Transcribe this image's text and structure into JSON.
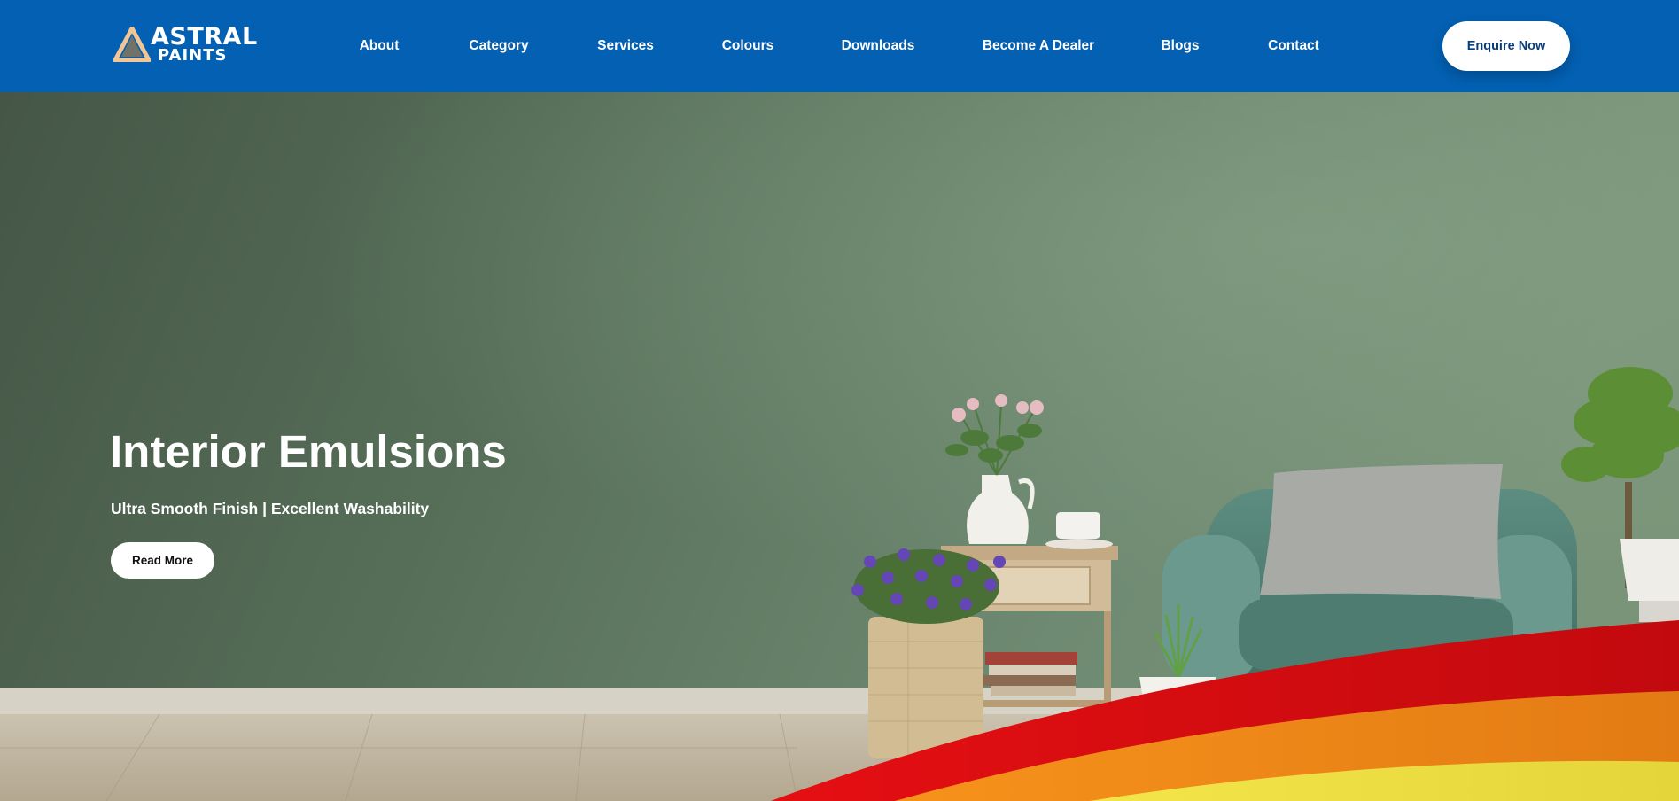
{
  "brand": {
    "logo_line1": "ASTRAL",
    "logo_line2": "PAINTS"
  },
  "nav": {
    "items": [
      {
        "label": "About"
      },
      {
        "label": "Category"
      },
      {
        "label": "Services"
      },
      {
        "label": "Colours"
      },
      {
        "label": "Downloads"
      },
      {
        "label": "Become A Dealer"
      },
      {
        "label": "Blogs"
      },
      {
        "label": "Contact"
      }
    ],
    "cta_label": "Enquire Now"
  },
  "hero": {
    "title": "Interior Emulsions",
    "subtitle": "Ultra Smooth Finish | Excellent Washability",
    "button_label": "Read More"
  },
  "colors": {
    "nav_background": "#0360b2",
    "wall_green": "#5b7560",
    "wave_red": "#d40d12",
    "wave_orange": "#f08418",
    "wave_yellow": "#ecde42"
  }
}
